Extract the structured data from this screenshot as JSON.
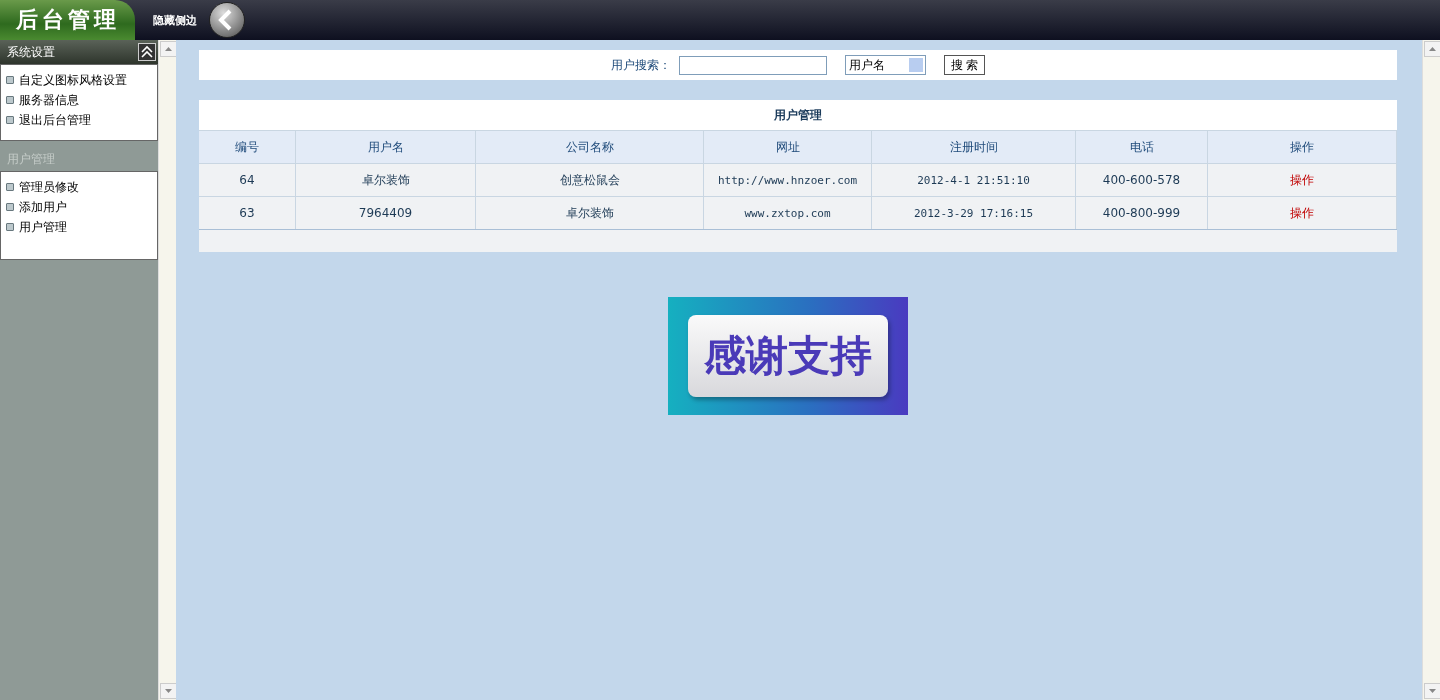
{
  "header": {
    "logo": "后台管理",
    "toggle_label": "隐藏侧边"
  },
  "sidebar": {
    "sections": [
      {
        "title": "系统设置",
        "expanded": true,
        "items": [
          "自定义图标风格设置",
          "服务器信息",
          "退出后台管理"
        ]
      },
      {
        "title": "用户管理",
        "expanded": false,
        "items": [
          "管理员修改",
          "添加用户",
          "用户管理"
        ]
      }
    ]
  },
  "search": {
    "label": "用户搜索：",
    "select_value": "用户名",
    "button": "搜 索"
  },
  "table": {
    "title": "用户管理",
    "columns": [
      "编号",
      "用户名",
      "公司名称",
      "网址",
      "注册时间",
      "电话",
      "操作"
    ],
    "rows": [
      [
        "64",
        "卓尔装饰",
        "创意松鼠会",
        "http://www.hnzoer.com",
        "2012-4-1 21:51:10",
        "400-600-578",
        "操作"
      ],
      [
        "63",
        "7964409",
        "卓尔装饰",
        "www.zxtop.com",
        "2012-3-29 17:16:15",
        "400-800-999",
        "操作"
      ]
    ]
  },
  "banner": {
    "text": "感谢支持"
  }
}
